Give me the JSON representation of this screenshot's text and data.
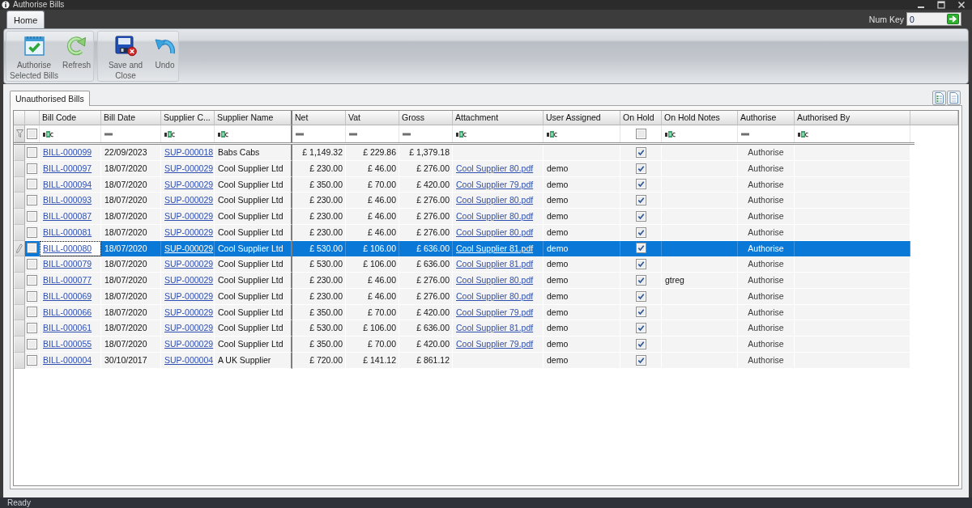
{
  "window": {
    "title": "Authorise Bills"
  },
  "ribbon": {
    "tabs": [
      {
        "label": "Home",
        "selected": true
      }
    ],
    "num_key": {
      "label": "Num Key",
      "value": "0"
    },
    "groups": [
      {
        "buttons": [
          {
            "kind": "authorise",
            "label": "Authorise Selected Bills"
          },
          {
            "kind": "refresh",
            "label": "Refresh"
          }
        ]
      },
      {
        "buttons": [
          {
            "kind": "save_close",
            "label": "Save and Close"
          },
          {
            "kind": "undo",
            "label": "Undo"
          }
        ]
      }
    ]
  },
  "document_tabs": [
    {
      "label": "Unauthorised Bills",
      "selected": true
    }
  ],
  "table": {
    "select_all": {
      "checked": false
    },
    "columns": [
      {
        "label": "Bill Code",
        "kind": "link",
        "filter": {
          "kind": "text"
        },
        "frozen_edge": false
      },
      {
        "label": "Bill Date",
        "kind": "text",
        "filter": {
          "kind": "equals"
        },
        "frozen_edge": false
      },
      {
        "label": "Supplier C...",
        "kind": "link",
        "filter": {
          "kind": "text"
        },
        "frozen_edge": false
      },
      {
        "label": "Supplier Name",
        "kind": "text",
        "filter": {
          "kind": "text"
        },
        "frozen_edge": true
      },
      {
        "label": "Net",
        "kind": "money",
        "filter": {
          "kind": "equals"
        },
        "frozen_edge": false
      },
      {
        "label": "Vat",
        "kind": "money",
        "filter": {
          "kind": "equals"
        },
        "frozen_edge": false
      },
      {
        "label": "Gross",
        "kind": "money",
        "filter": {
          "kind": "equals"
        },
        "frozen_edge": false
      },
      {
        "label": "Attachment",
        "kind": "link",
        "filter": {
          "kind": "text"
        },
        "frozen_edge": false
      },
      {
        "label": "User Assigned",
        "kind": "text",
        "filter": {
          "kind": "text"
        },
        "frozen_edge": false
      },
      {
        "label": "On Hold",
        "kind": "check",
        "filter": {
          "kind": "check",
          "checked": false
        },
        "frozen_edge": false
      },
      {
        "label": "On Hold Notes",
        "kind": "text",
        "filter": {
          "kind": "text"
        },
        "frozen_edge": false
      },
      {
        "label": "Authorise",
        "kind": "action",
        "filter": {
          "kind": "equals"
        },
        "frozen_edge": false
      },
      {
        "label": "Authorised By",
        "kind": "text",
        "filter": {
          "kind": "text"
        },
        "frozen_edge": false
      }
    ],
    "rows": [
      {
        "selected": false,
        "checked": false,
        "bill_code": "BILL-000099",
        "bill_date": "22/09/2023",
        "supplier_code": "SUP-000018",
        "supplier_name": "Babs Cabs",
        "net": "£ 1,149.32",
        "vat": "£ 229.86",
        "gross": "£ 1,379.18",
        "on_hold": true,
        "authorise": "Authorise"
      },
      {
        "selected": false,
        "checked": false,
        "bill_code": "BILL-000097",
        "bill_date": "18/07/2020",
        "supplier_code": "SUP-000029",
        "supplier_name": "Cool Supplier Ltd",
        "net": "£ 230.00",
        "vat": "£ 46.00",
        "gross": "£ 276.00",
        "attachment": "Cool Supplier 80.pdf",
        "user_assigned": "demo",
        "on_hold": true,
        "authorise": "Authorise"
      },
      {
        "selected": false,
        "checked": false,
        "bill_code": "BILL-000094",
        "bill_date": "18/07/2020",
        "supplier_code": "SUP-000029",
        "supplier_name": "Cool Supplier Ltd",
        "net": "£ 350.00",
        "vat": "£ 70.00",
        "gross": "£ 420.00",
        "attachment": "Cool Supplier 79.pdf",
        "user_assigned": "demo",
        "on_hold": true,
        "authorise": "Authorise"
      },
      {
        "selected": false,
        "checked": false,
        "bill_code": "BILL-000093",
        "bill_date": "18/07/2020",
        "supplier_code": "SUP-000029",
        "supplier_name": "Cool Supplier Ltd",
        "net": "£ 230.00",
        "vat": "£ 46.00",
        "gross": "£ 276.00",
        "attachment": "Cool Supplier 80.pdf",
        "user_assigned": "demo",
        "on_hold": true,
        "authorise": "Authorise"
      },
      {
        "selected": false,
        "checked": false,
        "bill_code": "BILL-000087",
        "bill_date": "18/07/2020",
        "supplier_code": "SUP-000029",
        "supplier_name": "Cool Supplier Ltd",
        "net": "£ 230.00",
        "vat": "£ 46.00",
        "gross": "£ 276.00",
        "attachment": "Cool Supplier 80.pdf",
        "user_assigned": "demo",
        "on_hold": true,
        "authorise": "Authorise"
      },
      {
        "selected": false,
        "checked": false,
        "bill_code": "BILL-000081",
        "bill_date": "18/07/2020",
        "supplier_code": "SUP-000029",
        "supplier_name": "Cool Supplier Ltd",
        "net": "£ 230.00",
        "vat": "£ 46.00",
        "gross": "£ 276.00",
        "attachment": "Cool Supplier 80.pdf",
        "user_assigned": "demo",
        "on_hold": true,
        "authorise": "Authorise"
      },
      {
        "selected": true,
        "checked": false,
        "bill_code": "BILL-000080",
        "bill_date": "18/07/2020",
        "supplier_code": "SUP-000029",
        "supplier_name": "Cool Supplier Ltd",
        "net": "£ 530.00",
        "vat": "£ 106.00",
        "gross": "£ 636.00",
        "attachment": "Cool Supplier 81.pdf",
        "user_assigned": "demo",
        "on_hold": true,
        "authorise": "Authorise"
      },
      {
        "selected": false,
        "checked": false,
        "bill_code": "BILL-000079",
        "bill_date": "18/07/2020",
        "supplier_code": "SUP-000029",
        "supplier_name": "Cool Supplier Ltd",
        "net": "£ 530.00",
        "vat": "£ 106.00",
        "gross": "£ 636.00",
        "attachment": "Cool Supplier 81.pdf",
        "user_assigned": "demo",
        "on_hold": true,
        "authorise": "Authorise"
      },
      {
        "selected": false,
        "checked": false,
        "bill_code": "BILL-000077",
        "bill_date": "18/07/2020",
        "supplier_code": "SUP-000029",
        "supplier_name": "Cool Supplier Ltd",
        "net": "£ 230.00",
        "vat": "£ 46.00",
        "gross": "£ 276.00",
        "attachment": "Cool Supplier 80.pdf",
        "user_assigned": "demo",
        "on_hold": true,
        "on_hold_notes": "gtreg",
        "authorise": "Authorise"
      },
      {
        "selected": false,
        "checked": false,
        "bill_code": "BILL-000069",
        "bill_date": "18/07/2020",
        "supplier_code": "SUP-000029",
        "supplier_name": "Cool Supplier Ltd",
        "net": "£ 230.00",
        "vat": "£ 46.00",
        "gross": "£ 276.00",
        "attachment": "Cool Supplier 80.pdf",
        "user_assigned": "demo",
        "on_hold": true,
        "authorise": "Authorise"
      },
      {
        "selected": false,
        "checked": false,
        "bill_code": "BILL-000066",
        "bill_date": "18/07/2020",
        "supplier_code": "SUP-000029",
        "supplier_name": "Cool Supplier Ltd",
        "net": "£ 350.00",
        "vat": "£ 70.00",
        "gross": "£ 420.00",
        "attachment": "Cool Supplier 79.pdf",
        "user_assigned": "demo",
        "on_hold": true,
        "authorise": "Authorise"
      },
      {
        "selected": false,
        "checked": false,
        "bill_code": "BILL-000061",
        "bill_date": "18/07/2020",
        "supplier_code": "SUP-000029",
        "supplier_name": "Cool Supplier Ltd",
        "net": "£ 530.00",
        "vat": "£ 106.00",
        "gross": "£ 636.00",
        "attachment": "Cool Supplier 81.pdf",
        "user_assigned": "demo",
        "on_hold": true,
        "authorise": "Authorise"
      },
      {
        "selected": false,
        "checked": false,
        "bill_code": "BILL-000055",
        "bill_date": "18/07/2020",
        "supplier_code": "SUP-000029",
        "supplier_name": "Cool Supplier Ltd",
        "net": "£ 350.00",
        "vat": "£ 70.00",
        "gross": "£ 420.00",
        "attachment": "Cool Supplier 79.pdf",
        "user_assigned": "demo",
        "on_hold": true,
        "authorise": "Authorise"
      },
      {
        "selected": false,
        "checked": false,
        "bill_code": "BILL-000004",
        "bill_date": "30/10/2017",
        "supplier_code": "SUP-000004",
        "supplier_name": "A UK Supplier",
        "net": "£ 720.00",
        "vat": "£ 141.12",
        "gross": "£ 861.12",
        "user_assigned": "demo",
        "on_hold": true,
        "authorise": "Authorise"
      }
    ]
  },
  "status_bar": {
    "text": "Ready"
  }
}
